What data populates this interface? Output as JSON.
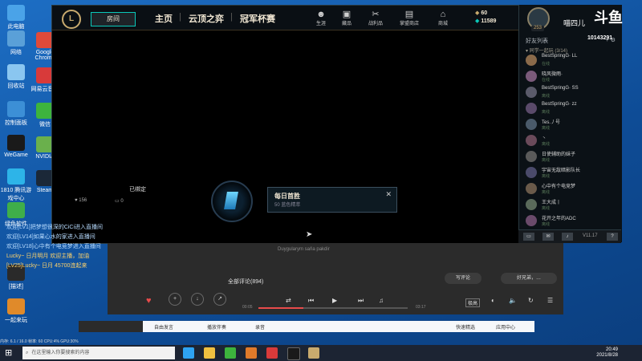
{
  "desktop": {
    "icons": [
      {
        "label": "此电脑",
        "color": "#4aa3e8"
      },
      {
        "label": "网络",
        "color": "#5aa0d8"
      },
      {
        "label": "回收站",
        "color": "#8ac6f0"
      },
      {
        "label": "控制面板",
        "color": "#3c8fd6"
      },
      {
        "label": "WeGame",
        "color": "#1a1a1a"
      },
      {
        "label": "1810\n腾讯游戏中心",
        "color": "#2db4e8"
      },
      {
        "label": "绿色软件",
        "color": "#3fae4a"
      },
      {
        "label": "[描述]",
        "color": "#2a2a2a"
      },
      {
        "label": "一起来玩",
        "color": "#e08a2a"
      }
    ],
    "right_icons": [
      {
        "label": "Google Chrome",
        "color": "#e04a3a"
      },
      {
        "label": "网易云音乐",
        "color": "#d83a3a"
      },
      {
        "label": "微信",
        "color": "#3db43d"
      },
      {
        "label": "NVIDIA",
        "color": "#6ab04c"
      },
      {
        "label": "Steam",
        "color": "#1b2838"
      }
    ]
  },
  "client": {
    "logo": "L",
    "play_label": "房间",
    "nav": [
      {
        "label": "主页"
      },
      {
        "label": "云顶之弈"
      },
      {
        "label": "冠军杯赛"
      }
    ],
    "top_icons": [
      {
        "glyph": "☻",
        "label": "生涯"
      },
      {
        "glyph": "▣",
        "label": "藏品"
      },
      {
        "glyph": "✂",
        "label": "战利品"
      },
      {
        "glyph": "▤",
        "label": "掌盟商店"
      },
      {
        "glyph": "⌂",
        "label": "商城"
      }
    ],
    "currency": {
      "rp": "60",
      "be": "11589"
    },
    "likes": "156",
    "comments": "0",
    "copy_label": "已绑定"
  },
  "notification": {
    "title": "每日首胜",
    "subtitle": "50 蓝色精萃"
  },
  "friends": {
    "header": "好友列表",
    "group": "▾ 同学一起玩 (3/14)",
    "level": "253",
    "rows": [
      {
        "name": "BestSpringG· LL",
        "status": "在线",
        "color": "#8a6a4a"
      },
      {
        "name": "晓风微雨·",
        "status": "在线",
        "color": "#7a5a7a"
      },
      {
        "name": "BestSpringG· SS",
        "status": "离线",
        "color": "#5a5a6a"
      },
      {
        "name": "BestSpringG· zz",
        "status": "离线",
        "color": "#5a4a6a"
      },
      {
        "name": "Tes.丿号",
        "status": "离线",
        "color": "#4a5a6a"
      },
      {
        "name": "丶",
        "status": "离线",
        "color": "#6a4a5a"
      },
      {
        "name": "日使辅助的妹子",
        "status": "离线",
        "color": "#5a5a5a"
      },
      {
        "name": "宇宙无敌暗影队长",
        "status": "离线",
        "color": "#4a4a6a"
      },
      {
        "name": "心中有个电竞梦",
        "status": "离线",
        "color": "#6a5a4a"
      },
      {
        "name": "王大成丨",
        "status": "离线",
        "color": "#5a6a5a"
      },
      {
        "name": "花开之年的ADC",
        "status": "离线",
        "color": "#6a4a6a"
      }
    ],
    "bottom_version": "V11.17"
  },
  "chat": {
    "lines": [
      {
        "text": "欢迎[LV1]把梦想很深的CiCi进入直播间",
        "color": "#b8dcff"
      },
      {
        "text": "欢迎[LV14]如果心水的家进入直播间",
        "color": "#b8dcff"
      },
      {
        "text": "欢迎[LV18]心中有个电竞梦进入直播间",
        "color": "#b8dcff"
      },
      {
        "text": "Lucky~ 日月明月 欢迎主播，加油",
        "color": "#ffd36a"
      },
      {
        "text": "[LV25]Lucky~ 日月 45700连起来",
        "color": "#ffd36a"
      }
    ]
  },
  "player": {
    "input": "Duygularym saňa pakdir",
    "comments": "全部评论(894)",
    "write": "写评论",
    "share": "好兄弟，…",
    "time_start": "00:05",
    "time_end": "03:17",
    "progress": 0.3,
    "quality": "极高"
  },
  "appbar": {
    "items": [
      "自由发言",
      "播放伴奏",
      "录音",
      "快速精选",
      "应用中心"
    ]
  },
  "status_text": "内存: 6.1 / 16.0 帧率: 60  CPU:4% GPU:30%",
  "taskbar": {
    "search_placeholder": "在这里输入你要搜索的内容",
    "time": "20:49",
    "date": "2021/8/28"
  },
  "watermark": {
    "logo": "斗鱼",
    "id": "10143291",
    "name": "喵四儿"
  }
}
